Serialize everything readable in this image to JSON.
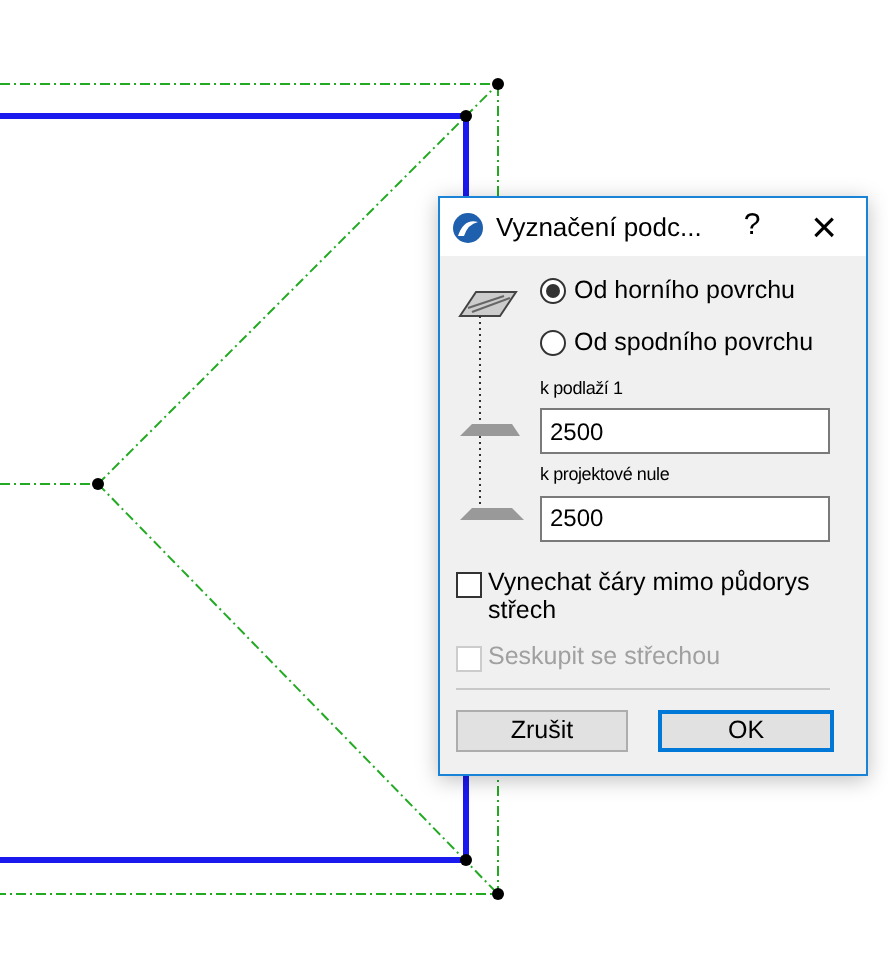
{
  "window": {
    "title": "Vyznačení podc...",
    "help": "?",
    "close": "×"
  },
  "options": [
    {
      "label": "Od horního povrchu",
      "selected": true
    },
    {
      "label": "Od spodního povrchu",
      "selected": false
    }
  ],
  "fields": [
    {
      "label": "k podlaží 1",
      "value": "2500"
    },
    {
      "label": "k projektové nule",
      "value": "2500"
    }
  ],
  "checkboxes": [
    {
      "label": "Vynechat čáry mimo půdorys střech",
      "checked": false,
      "disabled": false
    },
    {
      "label": "Seskupit se střechou",
      "checked": false,
      "disabled": true
    }
  ],
  "buttons": [
    {
      "label": "Zrušit",
      "default": false
    },
    {
      "label": "OK",
      "default": true
    }
  ]
}
